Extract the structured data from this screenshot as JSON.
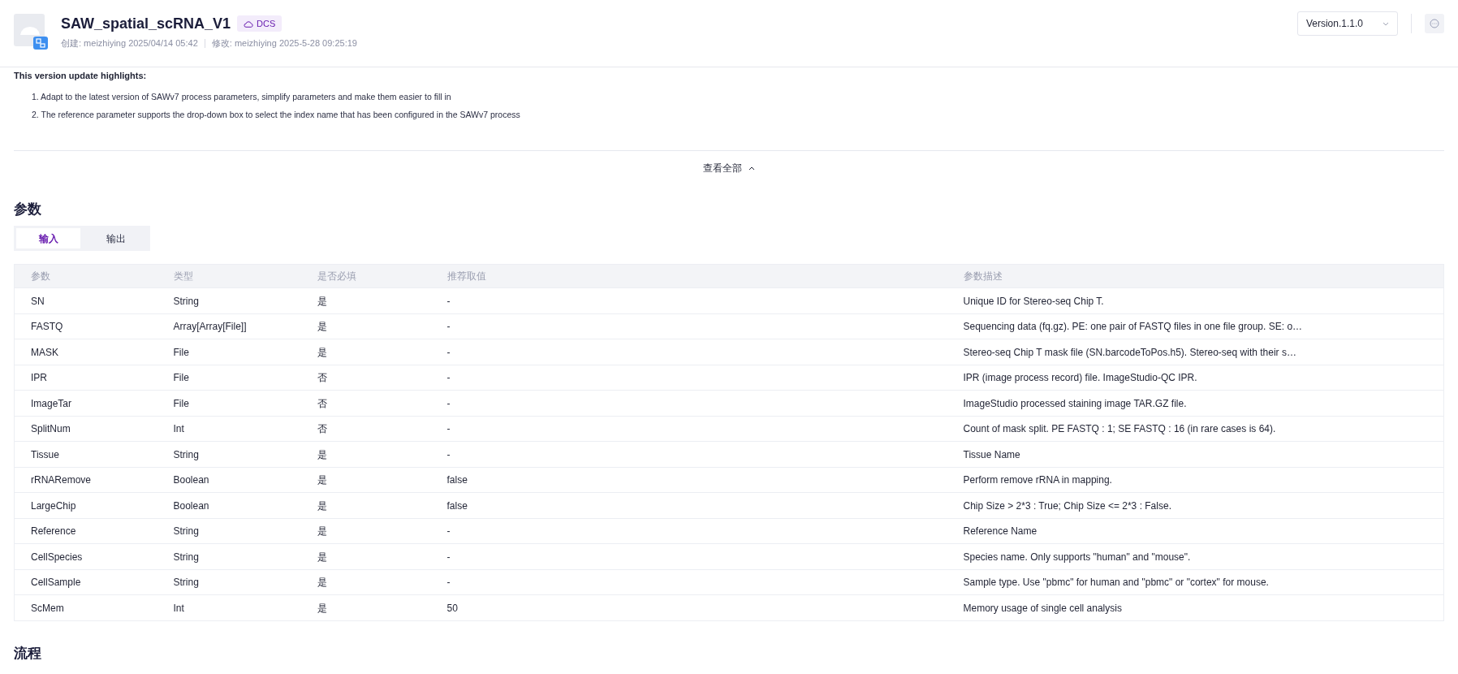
{
  "header": {
    "title": "SAW_spatial_scRNA_V1",
    "badge": "DCS",
    "created": "创建: meizhiying 2025/04/14 05:42",
    "modified": "修改: meizhiying 2025-5-28 09:25:19",
    "version": "Version.1.1.0"
  },
  "highlights": {
    "heading": "This version update highlights:",
    "items": [
      "1. Adapt to the latest version of SAWv7 process parameters, simplify parameters and make them easier to fill in",
      "2. The reference parameter supports the drop-down box to select the index name that has been configured in the SAWv7 process"
    ]
  },
  "expand_link": "查看全部",
  "params": {
    "heading": "参数",
    "tabs": [
      {
        "label": "输入",
        "selected": true
      },
      {
        "label": "输出",
        "selected": false
      }
    ],
    "table": {
      "columns": [
        "参数",
        "类型",
        "是否必填",
        "推荐取值",
        "参数描述"
      ],
      "rows": [
        [
          "SN",
          "String",
          "是",
          "-",
          "Unique ID for Stereo-seq Chip T."
        ],
        [
          "FASTQ",
          "Array[Array[File]]",
          "是",
          "-",
          "Sequencing data (fq.gz). PE: one pair of FASTQ files in one file group. SE: o…"
        ],
        [
          "MASK",
          "File",
          "是",
          "-",
          "Stereo-seq Chip T mask file (SN.barcodeToPos.h5). Stereo-seq with their s…"
        ],
        [
          "IPR",
          "File",
          "否",
          "-",
          "IPR (image process record) file. ImageStudio-QC IPR."
        ],
        [
          "ImageTar",
          "File",
          "否",
          "-",
          "ImageStudio processed staining image TAR.GZ file."
        ],
        [
          "SplitNum",
          "Int",
          "否",
          "-",
          "Count of mask split. PE FASTQ : 1; SE FASTQ : 16 (in rare cases is 64)."
        ],
        [
          "Tissue",
          "String",
          "是",
          "-",
          "Tissue Name"
        ],
        [
          "rRNARemove",
          "Boolean",
          "是",
          "false",
          "Perform remove rRNA in mapping."
        ],
        [
          "LargeChip",
          "Boolean",
          "是",
          "false",
          "Chip Size > 2*3 : True; Chip Size <= 2*3 : False."
        ],
        [
          "Reference",
          "String",
          "是",
          "-",
          "Reference Name"
        ],
        [
          "CellSpecies",
          "String",
          "是",
          "-",
          "Species name. Only supports \"human\" and \"mouse\"."
        ],
        [
          "CellSample",
          "String",
          "是",
          "-",
          "Sample type. Use \"pbmc\" for human and \"pbmc\" or \"cortex\" for mouse."
        ],
        [
          "ScMem",
          "Int",
          "是",
          "50",
          "Memory usage of single cell analysis"
        ]
      ]
    }
  },
  "flow": {
    "heading": "流程"
  }
}
